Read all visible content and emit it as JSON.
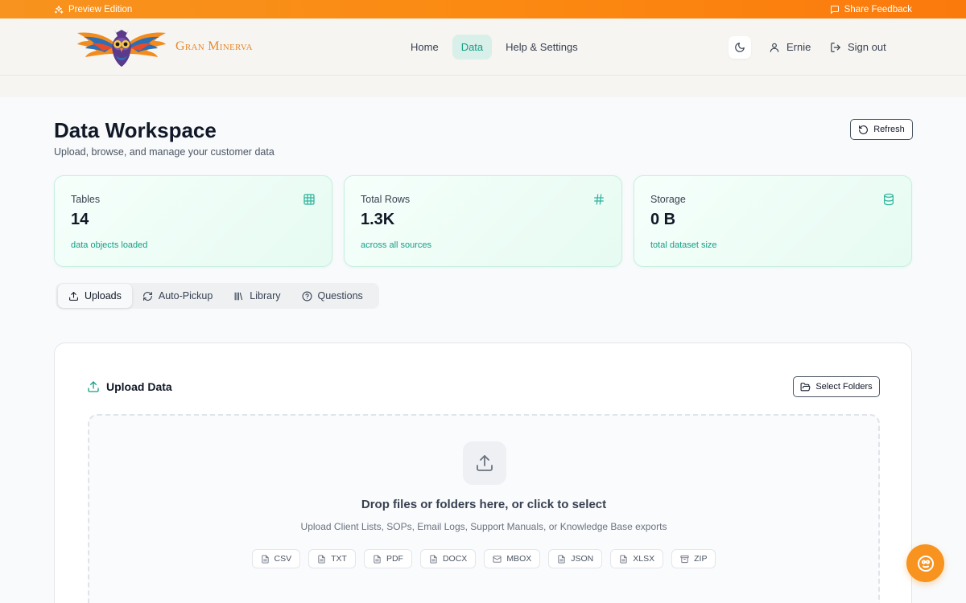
{
  "banner": {
    "left_label": "Preview Edition",
    "right_label": "Share Feedback",
    "left_icon": "sparkle-icon",
    "right_icon": "message-square-icon"
  },
  "brand": {
    "name": "Gran Minerva",
    "logo": "owl-logo",
    "color": "#e7892a"
  },
  "nav": {
    "items": [
      {
        "label": "Home",
        "active": false
      },
      {
        "label": "Data",
        "active": true
      },
      {
        "label": "Help & Settings",
        "active": false
      }
    ],
    "theme_icon": "moon-icon",
    "user_name": "Ernie",
    "sign_out_label": "Sign out"
  },
  "page": {
    "title": "Data Workspace",
    "subtitle": "Upload, browse, and manage your customer data",
    "refresh_label": "Refresh"
  },
  "stats": [
    {
      "label": "Tables",
      "value": "14",
      "description": "data objects loaded",
      "icon": "table-icon"
    },
    {
      "label": "Total Rows",
      "value": "1.3K",
      "description": "across all sources",
      "icon": "hash-icon"
    },
    {
      "label": "Storage",
      "value": "0 B",
      "description": "total dataset size",
      "icon": "database-icon"
    }
  ],
  "tabs": [
    {
      "label": "Uploads",
      "icon": "upload-icon",
      "active": true
    },
    {
      "label": "Auto-Pickup",
      "icon": "refresh-icon",
      "active": false
    },
    {
      "label": "Library",
      "icon": "library-icon",
      "active": false
    },
    {
      "label": "Questions",
      "icon": "help-circle-icon",
      "active": false
    }
  ],
  "upload": {
    "title": "Upload Data",
    "select_folders_label": "Select Folders",
    "drop_title": "Drop files or folders here, or click to select",
    "drop_subtitle": "Upload Client Lists, SOPs, Email Logs, Support Manuals, or Knowledge Base exports",
    "file_types": [
      {
        "label": "CSV",
        "icon": "file-icon"
      },
      {
        "label": "TXT",
        "icon": "file-icon"
      },
      {
        "label": "PDF",
        "icon": "file-icon"
      },
      {
        "label": "DOCX",
        "icon": "file-icon"
      },
      {
        "label": "MBOX",
        "icon": "mail-icon"
      },
      {
        "label": "JSON",
        "icon": "file-icon"
      },
      {
        "label": "XLSX",
        "icon": "file-icon"
      },
      {
        "label": "ZIP",
        "icon": "archive-icon"
      }
    ]
  },
  "colors": {
    "accent_orange": "#f7931e",
    "accent_teal": "#149e84",
    "nav_active_bg": "#d9efe9"
  }
}
